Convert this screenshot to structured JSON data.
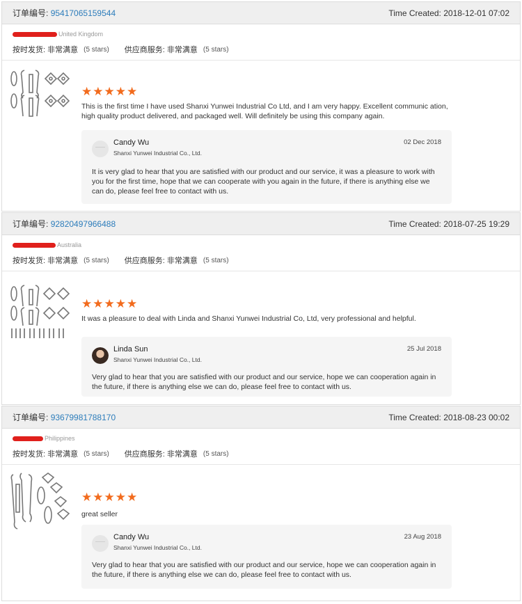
{
  "labels": {
    "order_label": "订单编号:",
    "time_created_label": "Time Created:",
    "shipping_label": "按时发货:",
    "service_label": "供应商服务:",
    "rating_text": "非常满意",
    "stars_note": "(5 stars)",
    "stars": "★★★★★"
  },
  "reviews": [
    {
      "order_number": "95417065159544",
      "time_created": "2018-12-01 07:02",
      "buyer_country": "United Kingdom",
      "feedback": "This is the first time I have used Shanxi Yunwei Industrial Co Ltd, and I am very happy. Excellent communic ation, high quality product delivered, and packaged well. Will definitely be using this company again.",
      "reply": {
        "seller_name": "Candy Wu",
        "company": "Shanxi Yunwei Industrial Co., Ltd.",
        "date": "02 Dec 2018",
        "text": "It is very glad to hear that you are satisfied with our product and our service, it was a pleasure to work with you for the first time, hope that we can cooperate with you again in the future, if there is anything else we can do, please feel free to contact with us."
      }
    },
    {
      "order_number": "92820497966488",
      "time_created": "2018-07-25 19:29",
      "buyer_country": "Australia",
      "feedback": "It was a pleasure to deal with Linda and Shanxi Yunwei Industrial Co, Ltd, very professional and helpful.",
      "reply": {
        "seller_name": "Linda Sun",
        "company": "Shanxi Yunwei Industrial Co., Ltd.",
        "date": "25 Jul 2018",
        "text": "Very glad to hear that you are satisfied with our product and our service, hope we can cooperation again in the future,  if there is anything else we can do, please feel free to contact with us."
      }
    },
    {
      "order_number": "93679981788170",
      "time_created": "2018-08-23 00:02",
      "buyer_country": "Philippines",
      "feedback": "great seller",
      "reply": {
        "seller_name": "Candy Wu",
        "company": "Shanxi Yunwei Industrial Co., Ltd.",
        "date": "23 Aug 2018",
        "text": "Very glad to hear that you are satisfied with our product and our service, hope we can cooperation again in the future, if there is anything else we can do, please feel free to contact with us."
      }
    }
  ]
}
